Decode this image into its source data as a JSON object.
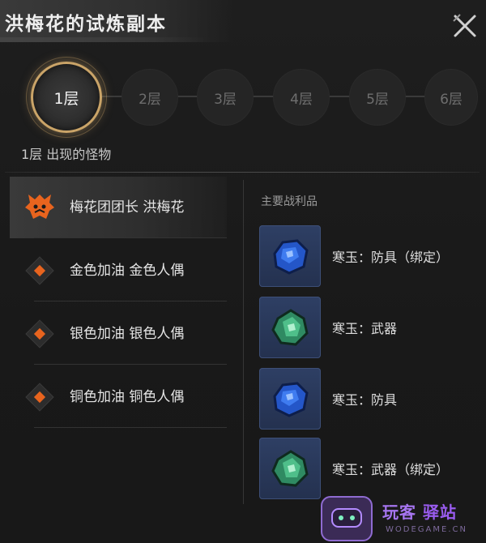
{
  "title": "洪梅花的试炼副本",
  "floors": [
    {
      "label": "1层",
      "active": true
    },
    {
      "label": "2层",
      "active": false
    },
    {
      "label": "3层",
      "active": false
    },
    {
      "label": "4层",
      "active": false
    },
    {
      "label": "5层",
      "active": false
    },
    {
      "label": "6层",
      "active": false
    }
  ],
  "floor_caption": "1层 出现的怪物",
  "monsters": [
    {
      "name": "梅花团团长 洪梅花",
      "icon": "demon-face-icon",
      "selected": true
    },
    {
      "name": "金色加油 金色人偶",
      "icon": "orange-diamond-icon",
      "selected": false
    },
    {
      "name": "银色加油 银色人偶",
      "icon": "orange-diamond-icon",
      "selected": false
    },
    {
      "name": "铜色加油 铜色人偶",
      "icon": "orange-diamond-icon",
      "selected": false
    }
  ],
  "loot_title": "主要战利品",
  "loot": [
    {
      "name": "寒玉：防具（绑定）",
      "icon": "blue-jade-icon"
    },
    {
      "name": "寒玉：武器",
      "icon": "green-jade-icon"
    },
    {
      "name": "寒玉：防具",
      "icon": "blue-jade-icon"
    },
    {
      "name": "寒玉：武器（绑定）",
      "icon": "green-jade-icon"
    }
  ],
  "watermark": {
    "brand_a": "玩客",
    "brand_b": "驿站",
    "url": "WODEGAME.CN"
  },
  "colors": {
    "accent_gold": "#caa468",
    "monster_orange": "#e8641e",
    "panel_bg": "#1a1a1a",
    "loot_bg": "#2a3a5c"
  }
}
